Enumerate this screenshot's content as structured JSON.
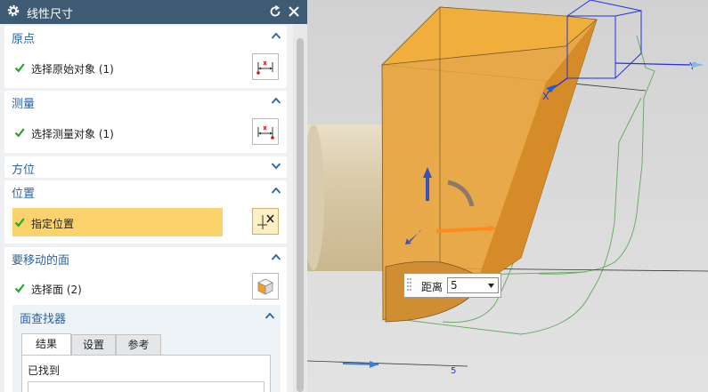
{
  "dialog": {
    "title": "线性尺寸",
    "icons": {
      "settings": "gear-icon",
      "reset": "reset-icon",
      "close": "close-icon"
    }
  },
  "sections": {
    "origin": {
      "header": "原点",
      "row_label": "选择原始对象 (1)"
    },
    "measure": {
      "header": "测量",
      "row_label": "选择测量对象 (1)"
    },
    "orientation": {
      "header": "方位"
    },
    "location": {
      "header": "位置",
      "row_label": "指定位置"
    },
    "move_face": {
      "header": "要移动的面",
      "row_label": "选择面 (2)"
    },
    "face_finder": {
      "header": "面查找器",
      "tabs": [
        "结果",
        "设置",
        "参考"
      ],
      "active_tab": "结果",
      "found_label": "已找到"
    }
  },
  "distance_popup": {
    "label": "距离",
    "value": "5"
  },
  "axis_labels": {
    "x": "X",
    "y": "Y",
    "tick": "5"
  },
  "colors": {
    "title_bar": "#3f5b73",
    "section_header_text": "#2a63a8",
    "highlight_row": "#fbd26b",
    "check_green": "#2aa52a",
    "model_orange": "#e9a33a"
  }
}
